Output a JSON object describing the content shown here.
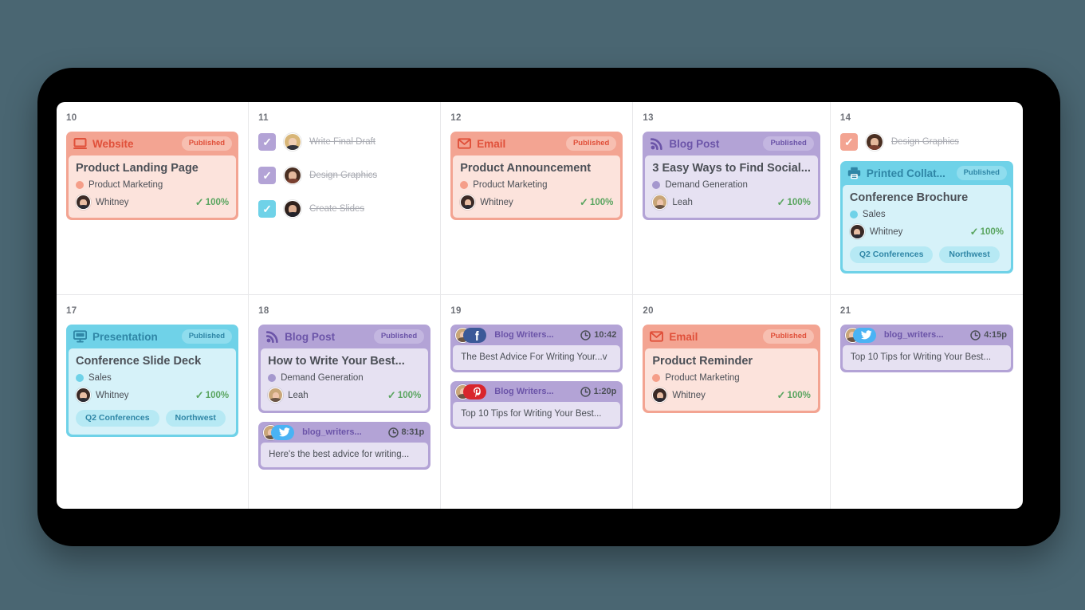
{
  "colors": {
    "background": "#4a6672",
    "device_frame": "#000000",
    "screen": "#ffffff",
    "grid_line": "#e8e8ea",
    "day_number": "#6f7279",
    "red_header": "#f3a492",
    "red_body": "#fce3dc",
    "red_text": "#e0503a",
    "red_badge_bg": "#f7bfb1",
    "purple_header": "#b3a3d6",
    "purple_body": "#e6e1f2",
    "purple_text": "#6b54a8",
    "purple_badge_bg": "#c3b6e0",
    "blue_header": "#6fd2e8",
    "blue_body": "#d6f2f9",
    "blue_text": "#2f86a6",
    "blue_badge_bg": "#8fddee",
    "tag_bg": "#b6e9f4",
    "tag_text": "#2f86a6",
    "progress_green": "#5aa560",
    "task_text": "#a9abb2",
    "campaign_red": "#f59e89",
    "campaign_purple": "#a598ce",
    "campaign_blue": "#6fd2e8",
    "facebook": "#3b5998",
    "twitter": "#4ab3f4",
    "pinterest": "#d9262d"
  },
  "labels": {
    "published": "Published",
    "check_glyph": "✓",
    "progress_100": "100%"
  },
  "days": [
    {
      "number": "10",
      "items": [
        {
          "kind": "content",
          "theme": "red",
          "icon": "website-monitor-icon",
          "type_label": "Website",
          "status": "Published",
          "title": "Product Landing Page",
          "campaign": "Product Marketing",
          "campaign_color": "campaign_red",
          "assignee": "Whitney",
          "avatar": "av-whitney",
          "progress": "100%",
          "tags": []
        }
      ]
    },
    {
      "number": "11",
      "items": [
        {
          "kind": "tasks",
          "tasks": [
            {
              "label": "Write Final Draft",
              "checkbox_theme": "purple",
              "avatar": "av-blonde"
            },
            {
              "label": "Design Graphics",
              "checkbox_theme": "purple",
              "avatar": "av-brunette"
            },
            {
              "label": "Create Slides",
              "checkbox_theme": "blue",
              "avatar": "av-dark"
            }
          ]
        }
      ]
    },
    {
      "number": "12",
      "items": [
        {
          "kind": "content",
          "theme": "red",
          "icon": "email-envelope-icon",
          "type_label": "Email",
          "status": "Published",
          "title": "Product Announcement",
          "campaign": "Product Marketing",
          "campaign_color": "campaign_red",
          "assignee": "Whitney",
          "avatar": "av-whitney",
          "progress": "100%",
          "tags": []
        }
      ]
    },
    {
      "number": "13",
      "items": [
        {
          "kind": "content",
          "theme": "purple",
          "icon": "blog-rss-icon",
          "type_label": "Blog Post",
          "status": "Published",
          "title": "3 Easy Ways to Find Social...",
          "campaign": "Demand Generation",
          "campaign_color": "campaign_purple",
          "assignee": "Leah",
          "avatar": "av-leah",
          "progress": "100%",
          "tags": []
        }
      ]
    },
    {
      "number": "14",
      "items": [
        {
          "kind": "tasks",
          "tasks": [
            {
              "label": "Design Graphics",
              "checkbox_theme": "red",
              "avatar": "av-brunette"
            }
          ]
        },
        {
          "kind": "content",
          "theme": "blue",
          "icon": "printer-icon",
          "type_label": "Printed Collat...",
          "status": "Published",
          "title": "Conference Brochure",
          "campaign": "Sales",
          "campaign_color": "campaign_blue",
          "assignee": "Whitney",
          "avatar": "av-whitney",
          "progress": "100%",
          "tags": [
            "Q2 Conferences",
            "Northwest"
          ]
        }
      ]
    },
    {
      "number": "17",
      "items": [
        {
          "kind": "content",
          "theme": "blue",
          "icon": "presentation-screen-icon",
          "type_label": "Presentation",
          "status": "Published",
          "title": "Conference Slide Deck",
          "campaign": "Sales",
          "campaign_color": "campaign_blue",
          "assignee": "Whitney",
          "avatar": "av-whitney",
          "progress": "100%",
          "tags": [
            "Q2 Conferences",
            "Northwest"
          ]
        }
      ]
    },
    {
      "number": "18",
      "items": [
        {
          "kind": "content",
          "theme": "purple",
          "icon": "blog-rss-icon",
          "type_label": "Blog Post",
          "status": "Published",
          "title": "How to Write Your Best...",
          "campaign": "Demand Generation",
          "campaign_color": "campaign_purple",
          "assignee": "Leah",
          "avatar": "av-leah",
          "progress": "100%",
          "tags": []
        },
        {
          "kind": "social",
          "theme": "purple",
          "network": "twitter",
          "handle": "blog_writers...",
          "time": "8:31p",
          "avatar": "av-leah",
          "message": "Here's the best advice for writing..."
        }
      ]
    },
    {
      "number": "19",
      "items": [
        {
          "kind": "social",
          "theme": "purple",
          "network": "facebook",
          "handle": "Blog Writers...",
          "time": "10:42",
          "avatar": "av-leah",
          "message": "The Best Advice For Writing Your...v"
        },
        {
          "kind": "social",
          "theme": "purple",
          "network": "pinterest",
          "handle": "Blog Writers...",
          "time": "1:20p",
          "avatar": "av-leah",
          "message": "Top 10 Tips for Writing Your Best..."
        }
      ]
    },
    {
      "number": "20",
      "items": [
        {
          "kind": "content",
          "theme": "red",
          "icon": "email-envelope-icon",
          "type_label": "Email",
          "status": "Published",
          "title": "Product Reminder",
          "campaign": "Product Marketing",
          "campaign_color": "campaign_red",
          "assignee": "Whitney",
          "avatar": "av-whitney",
          "progress": "100%",
          "tags": []
        }
      ]
    },
    {
      "number": "21",
      "items": [
        {
          "kind": "social",
          "theme": "purple",
          "network": "twitter",
          "handle": "blog_writers...",
          "time": "4:15p",
          "avatar": "av-leah",
          "message": "Top 10 Tips for Writing Your Best..."
        }
      ]
    }
  ]
}
